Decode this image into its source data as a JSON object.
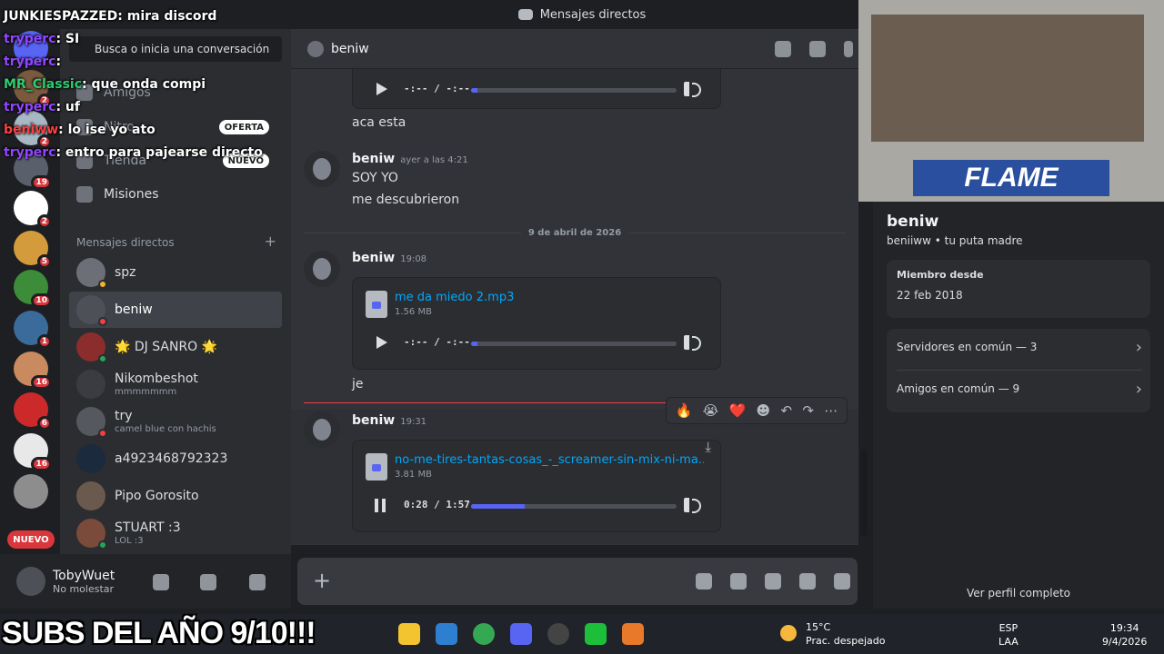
{
  "window": {
    "title": "Mensajes directos"
  },
  "guild_badges": [
    "2",
    "2",
    "19",
    "2",
    "5",
    "10",
    "1",
    "16",
    "6",
    "16"
  ],
  "sidebar": {
    "search_label": "Busca o inicia una conversación",
    "nav": [
      {
        "label": "Amigos"
      },
      {
        "label": "Nitro",
        "pill": "OFERTA"
      },
      {
        "label": "Tienda",
        "pill": "NUEVO"
      },
      {
        "label": "Misiones"
      }
    ],
    "dm_header": "Mensajes directos",
    "dms": [
      {
        "name": "spz",
        "sub": ""
      },
      {
        "name": "beniw",
        "sub": ""
      },
      {
        "name": "🌟 DJ SANRO 🌟",
        "sub": ""
      },
      {
        "name": "Nikombeshot",
        "sub": "mmmmmmm"
      },
      {
        "name": "try",
        "sub": "camel blue con hachis"
      },
      {
        "name": "a4923468792323",
        "sub": ""
      },
      {
        "name": "Pipo Gorosito",
        "sub": ""
      },
      {
        "name": "STUART :3",
        "sub": "LOL :3"
      }
    ],
    "nuevo_pill": "NUEVO"
  },
  "userbar": {
    "name": "TobyWuet",
    "status": "No molestar"
  },
  "chat_header": {
    "title": "beniw"
  },
  "messages": {
    "player_top": {
      "time": "-:-- / -:--"
    },
    "text_aca": "aca esta",
    "m1": {
      "author": "beniw",
      "time": "ayer a las 4:21",
      "lines": [
        "SOY YO",
        "me descubrieron"
      ]
    },
    "date_divider": "9 de abril de 2026",
    "m2": {
      "author": "beniw",
      "time": "19:08",
      "file": "me da miedo 2.mp3",
      "size": "1.56 MB",
      "player_time": "-:-- / -:--",
      "after": "je"
    },
    "m3": {
      "author": "beniw",
      "time": "19:31",
      "file": "no-me-tires-tantas-cosas_-_screamer-sin-mix-ni-ma...",
      "size": "3.81 MB",
      "player_time": "0:28 / 1:57",
      "progress": 0.26
    }
  },
  "toolbar_reactions": [
    "🔥",
    "😭",
    "❤️",
    "☻",
    "↶",
    "↷",
    "⋯"
  ],
  "profile": {
    "name": "beniw",
    "sub": "beniiww • tu puta madre",
    "member_label": "Miembro desde",
    "member_value": "22 feb 2018",
    "servers": "Servidores en común — 3",
    "friends": "Amigos en común — 9",
    "full": "Ver perfil completo"
  },
  "stream_chat": [
    {
      "user": "JUNKIESPAZZED",
      "text": ": mira discord",
      "c": 0
    },
    {
      "user": "tryperc",
      "text": ": SI",
      "c": 1
    },
    {
      "user": "tryperc",
      "text": ":",
      "c": 1
    },
    {
      "user": "MR_Classic",
      "text": ": que onda compi",
      "c": 2
    },
    {
      "user": "tryperc",
      "text": ": uf",
      "c": 1
    },
    {
      "user": "beniww",
      "text": ": lo ise yo ato",
      "c": 3
    },
    {
      "user": "tryperc",
      "text": ": entro para pajearse directo",
      "c": 1
    }
  ],
  "overlay_text": "SUBS DEL AÑO 9/10!!!",
  "taskbar": {
    "weather_temp": "15°C",
    "weather_desc": "Prac. despejado",
    "lang1": "ESP",
    "lang2": "LAA",
    "clock_time": "19:34",
    "clock_date": "9/4/2026"
  },
  "colors": {
    "accent": "#5865f2",
    "danger": "#da373c",
    "link": "#00a8fc"
  }
}
